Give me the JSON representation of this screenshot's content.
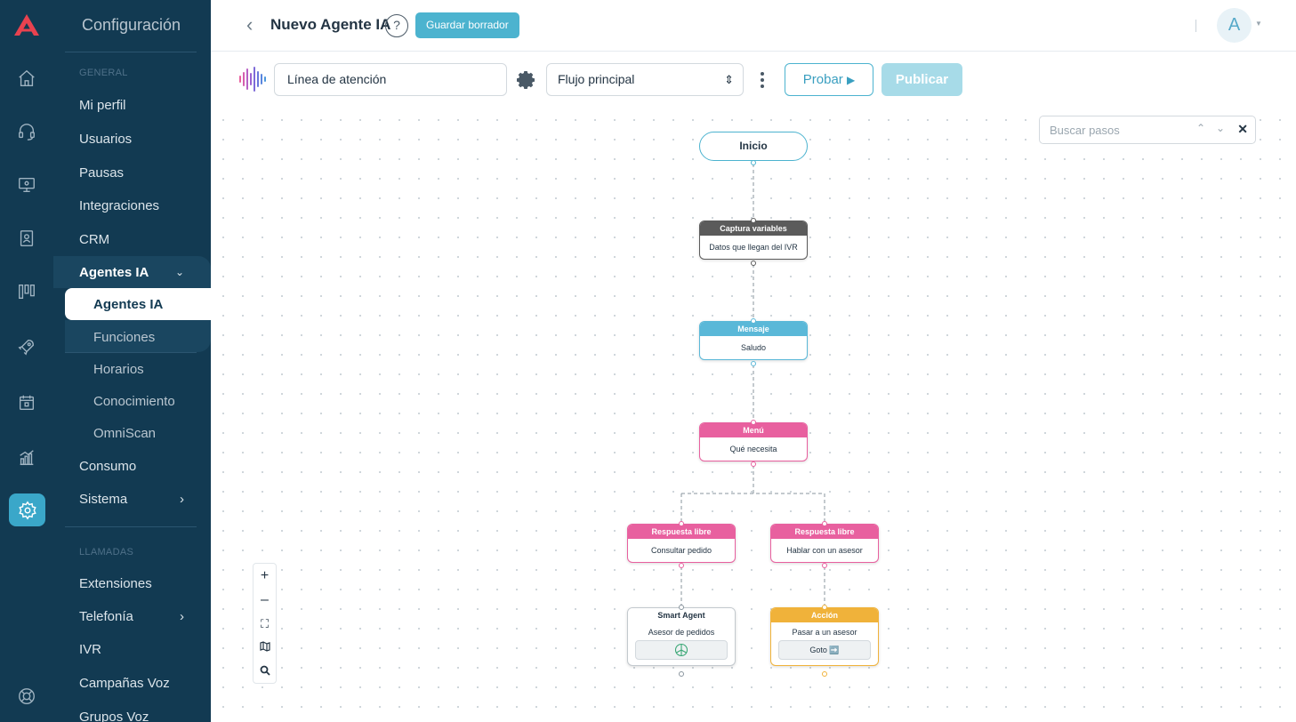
{
  "sidebar": {
    "title": "Configuración",
    "section_general": "GENERAL",
    "items": [
      "Mi perfil",
      "Usuarios",
      "Pausas",
      "Integraciones",
      "CRM"
    ],
    "group_label": "Agentes IA",
    "group_items": [
      "Agentes IA",
      "Funciones",
      "Horarios",
      "Conocimiento",
      "OmniScan"
    ],
    "items2": [
      "Consumo",
      "Sistema"
    ],
    "section_calls": "LLAMADAS",
    "items3": [
      "Extensiones",
      "Telefonía",
      "IVR",
      "Campañas Voz",
      "Grupos Voz"
    ]
  },
  "header": {
    "title": "Nuevo Agente IA",
    "help": "?",
    "draft_button": "Guardar borrador",
    "avatar_letter": "A"
  },
  "toolbar": {
    "name_value": "Línea de atención",
    "flow_select": "Flujo principal",
    "test_button": "Probar",
    "publish_button": "Publicar"
  },
  "canvas": {
    "search_placeholder": "Buscar pasos",
    "nodes": {
      "start": "Inicio",
      "capture_header": "Captura variables",
      "capture_body": "Datos que llegan del IVR",
      "message_header": "Mensaje",
      "message_body": "Saludo",
      "menu_header": "Menú",
      "menu_body": "Qué necesita",
      "free1_header": "Respuesta libre",
      "free1_body": "Consultar pedido",
      "free2_header": "Respuesta libre",
      "free2_body": "Hablar con un asesor",
      "smart_header": "Smart Agent",
      "smart_body": "Asesor de pedidos",
      "action_header": "Acción",
      "action_body": "Pasar a un asesor",
      "action_button": "Goto ➡️"
    }
  },
  "colors": {
    "sidebar_bg": "#123a52",
    "accent": "#4cb3cf",
    "capture": "#5b5b5b",
    "message": "#5ab8d8",
    "menu": "#e8609f",
    "action": "#f0b23a"
  }
}
